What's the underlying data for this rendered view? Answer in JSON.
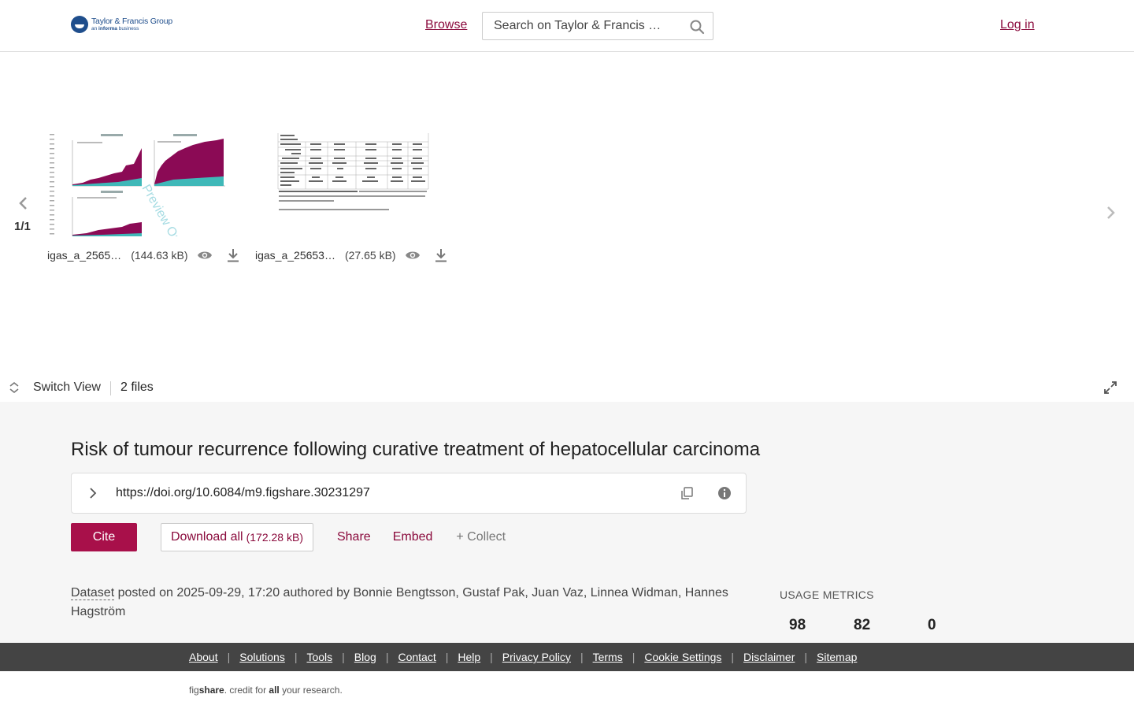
{
  "header": {
    "logo_main": "Taylor & Francis Group",
    "logo_sub_prefix": "an",
    "logo_sub_bold": "informa",
    "logo_sub_suffix": "business",
    "browse_label": "Browse",
    "search_placeholder": "Search on Taylor & Francis …",
    "login_label": "Log in"
  },
  "viewer": {
    "counter": "1/1",
    "files": [
      {
        "name": "igas_a_2565…",
        "size": "(144.63 kB)"
      },
      {
        "name": "igas_a_25653…",
        "size": "(27.65 kB)"
      }
    ],
    "watermark": "Preview Only",
    "switch_view_label": "Switch View",
    "files_count": "2 files"
  },
  "item": {
    "title": "Risk of tumour recurrence following curative treatment of hepatocellular carcinoma",
    "doi": "https://doi.org/10.6084/m9.figshare.30231297",
    "cite_label": "Cite",
    "download_all_label": "Download all",
    "download_all_size": "(172.28 kB)",
    "share_label": "Share",
    "embed_label": "Embed",
    "collect_label": "+ Collect",
    "type_label": "Dataset",
    "posted_text": "posted on 2025-09-29, 17:20 authored by Bonnie Bengtsson, Gustaf Pak, Juan Vaz, Linnea Widman, Hannes Hagström"
  },
  "usage": {
    "title": "USAGE METRICS",
    "values": [
      "98",
      "82",
      "0"
    ]
  },
  "footer": {
    "links": [
      "About",
      "Solutions",
      "Tools",
      "Blog",
      "Contact",
      "Help",
      "Privacy Policy",
      "Terms",
      "Cookie Settings",
      "Disclaimer",
      "Sitemap"
    ],
    "credit_pre": "fig",
    "credit_brand": "share",
    "credit_mid": ". credit for ",
    "credit_all": "all",
    "credit_post": " your research."
  },
  "colors": {
    "accent": "#a8104a",
    "link": "#8a0a3c",
    "chart_purple": "#8b0a55",
    "chart_teal": "#3fb8b8",
    "footer_bg": "#444444"
  }
}
